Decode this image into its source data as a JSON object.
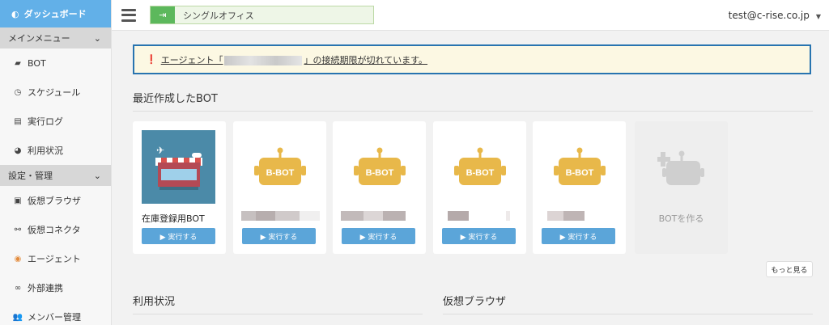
{
  "sidebar": {
    "dashboard": "ダッシュボード",
    "sections": [
      {
        "title": "メインメニュー",
        "items": [
          {
            "label": "BOT",
            "icon": "bot-icon"
          },
          {
            "label": "スケジュール",
            "icon": "clock-icon"
          },
          {
            "label": "実行ログ",
            "icon": "document-icon"
          },
          {
            "label": "利用状況",
            "icon": "pie-chart-icon"
          }
        ]
      },
      {
        "title": "設定・管理",
        "items": [
          {
            "label": "仮想ブラウザ",
            "icon": "browser-icon"
          },
          {
            "label": "仮想コネクタ",
            "icon": "connector-icon"
          },
          {
            "label": "エージェント",
            "icon": "agent-icon"
          },
          {
            "label": "外部連携",
            "icon": "link-icon"
          },
          {
            "label": "メンバー管理",
            "icon": "users-icon"
          }
        ]
      }
    ]
  },
  "topbar": {
    "office": "シングルオフィス",
    "user": "test@c-rise.co.jp"
  },
  "alert": {
    "prefix": "エージェント「",
    "suffix": "」の接続期限が切れています。"
  },
  "recent": {
    "heading": "最近作成したBOT",
    "bot_badge": "B-BOT",
    "cards": [
      {
        "title": "在庫登録用BOT",
        "run": "▶ 実行する"
      },
      {
        "title": "",
        "run": "▶ 実行する"
      },
      {
        "title": "",
        "run": "▶ 実行する"
      },
      {
        "title": "",
        "run": "▶ 実行する"
      },
      {
        "title": "",
        "run": "▶ 実行する"
      }
    ],
    "create": "BOTを作る",
    "more": "もっと見る"
  },
  "usage": {
    "heading": "利用状況"
  },
  "vbrowser": {
    "heading": "仮想ブラウザ"
  },
  "colors": {
    "accent": "#62b0e8",
    "run_button": "#5ba5d9",
    "bot_yellow": "#e8b84a",
    "alert_border": "#2874b0"
  }
}
